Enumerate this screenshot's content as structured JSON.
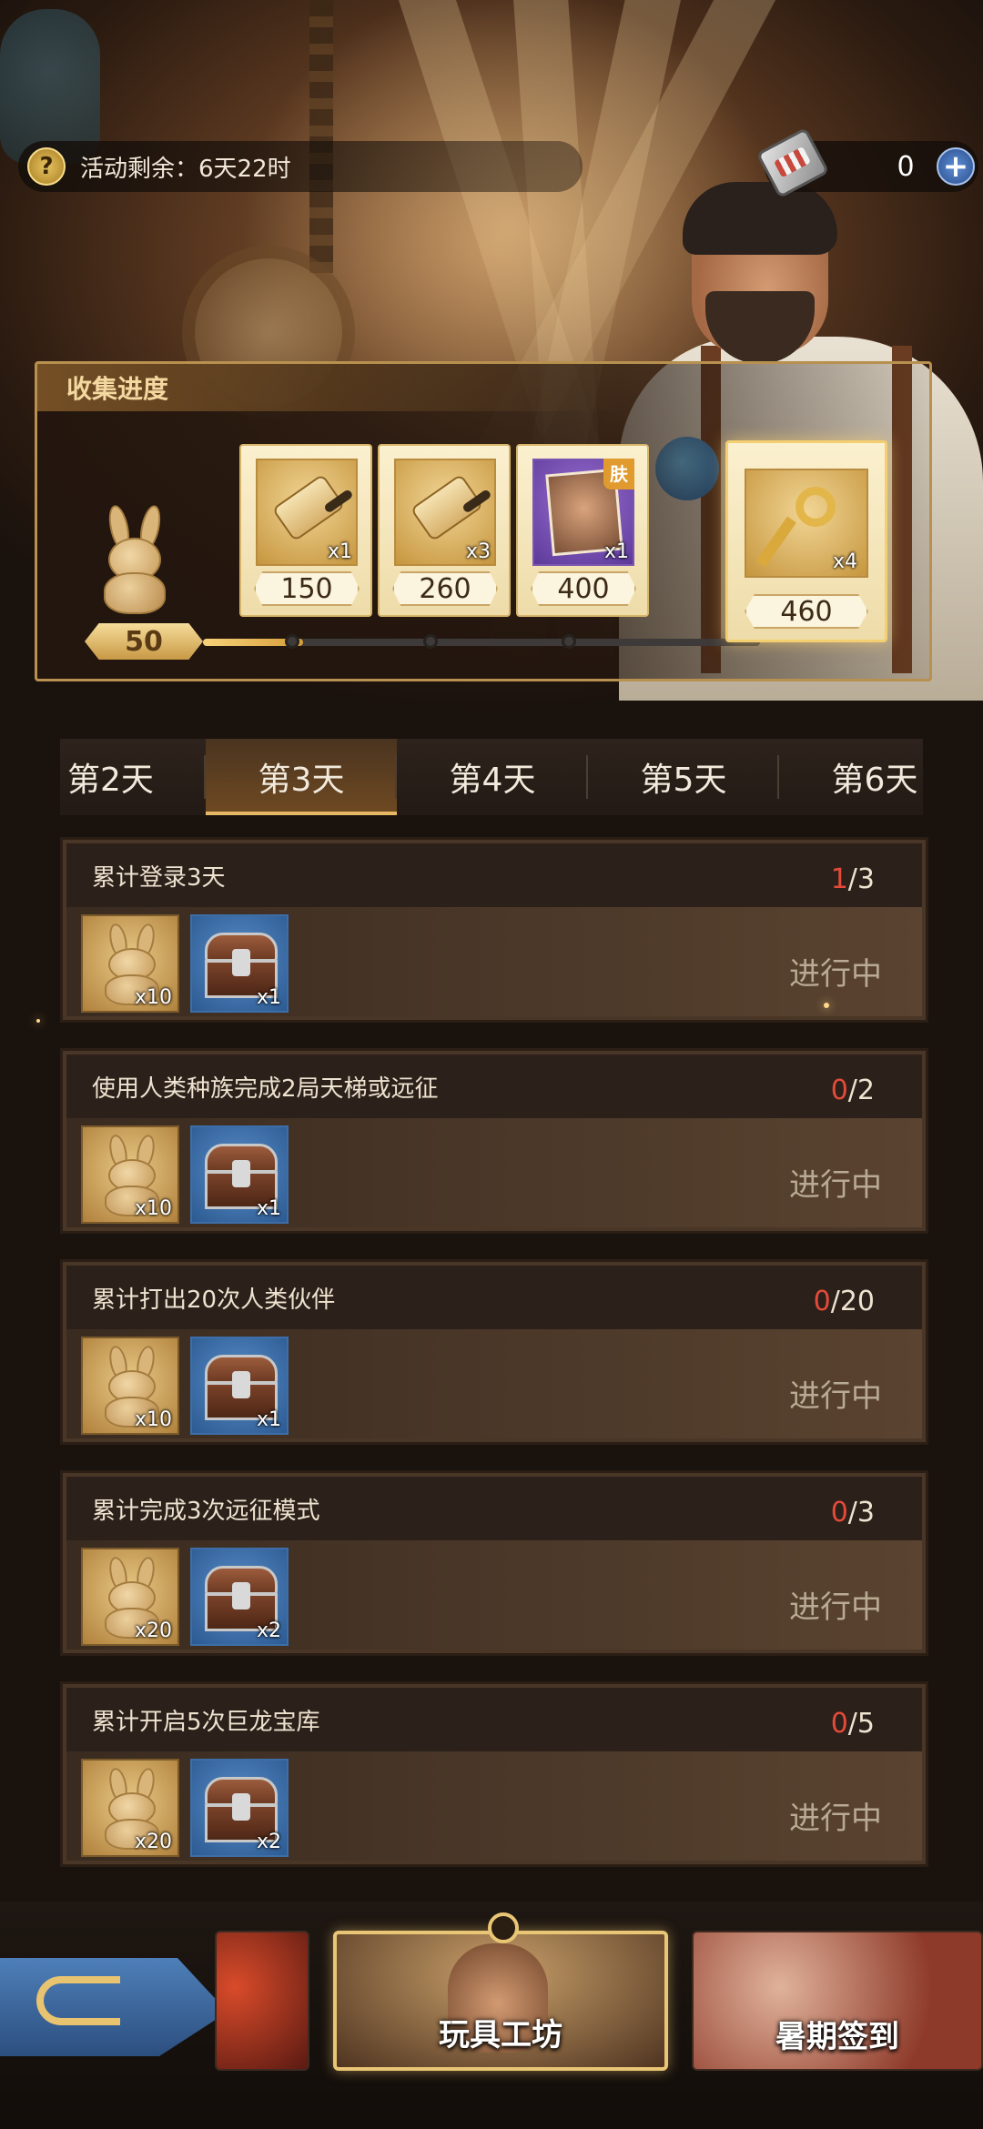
{
  "header": {
    "activity_remaining": "活动剩余：6天22时",
    "currency_count": "0",
    "plus_label": "+"
  },
  "collection": {
    "title": "收集进度",
    "current_count": "50",
    "progress_fraction": 0.18,
    "rewards": [
      {
        "quantity": "x1",
        "threshold": "150",
        "icon": "scroll-icon"
      },
      {
        "quantity": "x3",
        "threshold": "260",
        "icon": "scroll-icon"
      },
      {
        "quantity": "x1",
        "threshold": "400",
        "icon": "skin-card-icon",
        "tag": "肤"
      },
      {
        "quantity": "x4",
        "threshold": "460",
        "icon": "golden-key-icon"
      }
    ]
  },
  "day_tabs": [
    {
      "label": "第2天",
      "active": false
    },
    {
      "label": "第3天",
      "active": true
    },
    {
      "label": "第4天",
      "active": false
    },
    {
      "label": "第5天",
      "active": false
    },
    {
      "label": "第6天",
      "active": false
    }
  ],
  "tasks": [
    {
      "title": "累计登录3天",
      "current": "1",
      "total": "/3",
      "rewards": [
        "x10",
        "x1"
      ],
      "status": "进行中"
    },
    {
      "title": "使用人类种族完成2局天梯或远征",
      "current": "0",
      "total": "/2",
      "rewards": [
        "x10",
        "x1"
      ],
      "status": "进行中"
    },
    {
      "title": "累计打出20次人类伙伴",
      "current": "0",
      "total": "/20",
      "rewards": [
        "x10",
        "x1"
      ],
      "status": "进行中"
    },
    {
      "title": "累计完成3次远征模式",
      "current": "0",
      "total": "/3",
      "rewards": [
        "x20",
        "x2"
      ],
      "status": "进行中"
    },
    {
      "title": "累计开启5次巨龙宝库",
      "current": "0",
      "total": "/5",
      "rewards": [
        "x20",
        "x2"
      ],
      "status": "进行中"
    }
  ],
  "bottom_nav": {
    "center_label": "玩具工坊",
    "right_label": "暑期签到"
  },
  "colors": {
    "accent_gold": "#e6b764",
    "progress_red": "#e54a3a",
    "panel_brown": "#4a3626"
  }
}
